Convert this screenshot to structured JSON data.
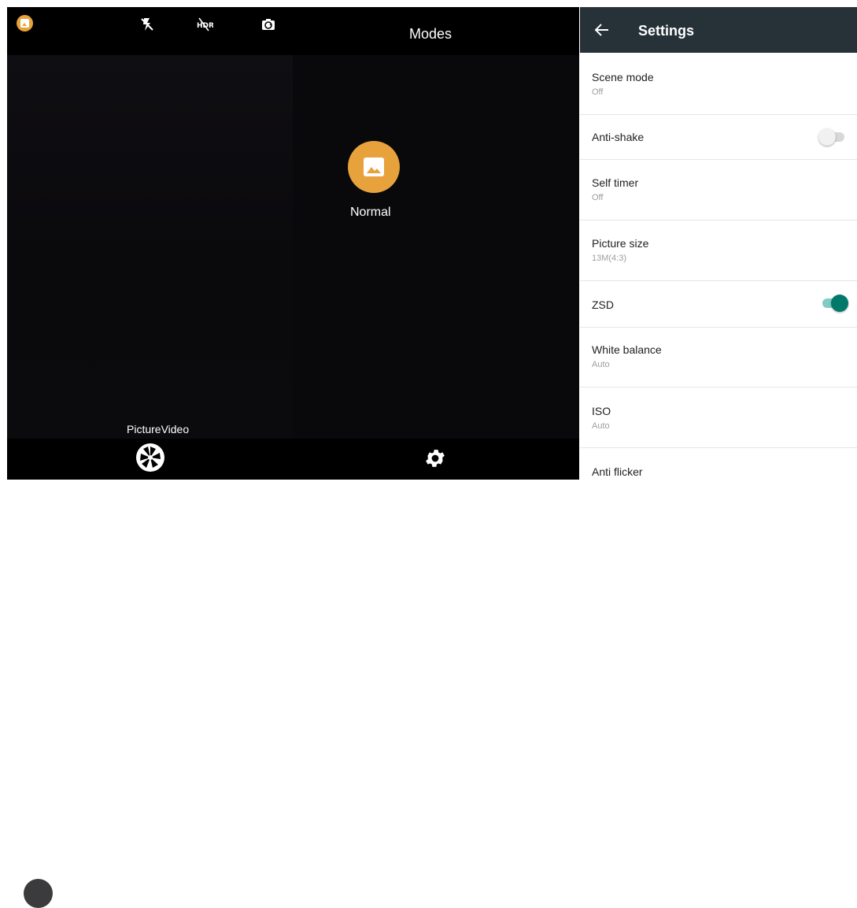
{
  "camera": {
    "top_icons": [
      "picture-mode-icon",
      "flash-off-icon",
      "hdr-off-icon",
      "switch-camera-icon"
    ],
    "mode_label": "PictureVideo",
    "shutter_icon": "shutter-icon"
  },
  "modes": {
    "title": "Modes",
    "items": [
      {
        "label": "Normal",
        "icon": "image-icon",
        "color": "#e8a23b"
      }
    ],
    "settings_icon": "gear-icon"
  },
  "settings": {
    "title": "Settings",
    "back_icon": "back-arrow-icon",
    "header_color": "#263238",
    "accent_color": "#00796b",
    "items": [
      {
        "label": "Scene mode",
        "value": "Off"
      },
      {
        "label": "Anti-shake",
        "toggle": false
      },
      {
        "label": "Self timer",
        "value": "Off"
      },
      {
        "label": "Picture size",
        "value": "13M(4:3)"
      },
      {
        "label": "ZSD",
        "toggle": true
      },
      {
        "label": "White balance",
        "value": "Auto"
      },
      {
        "label": "ISO",
        "value": "Auto"
      },
      {
        "label": "Anti flicker"
      }
    ]
  }
}
